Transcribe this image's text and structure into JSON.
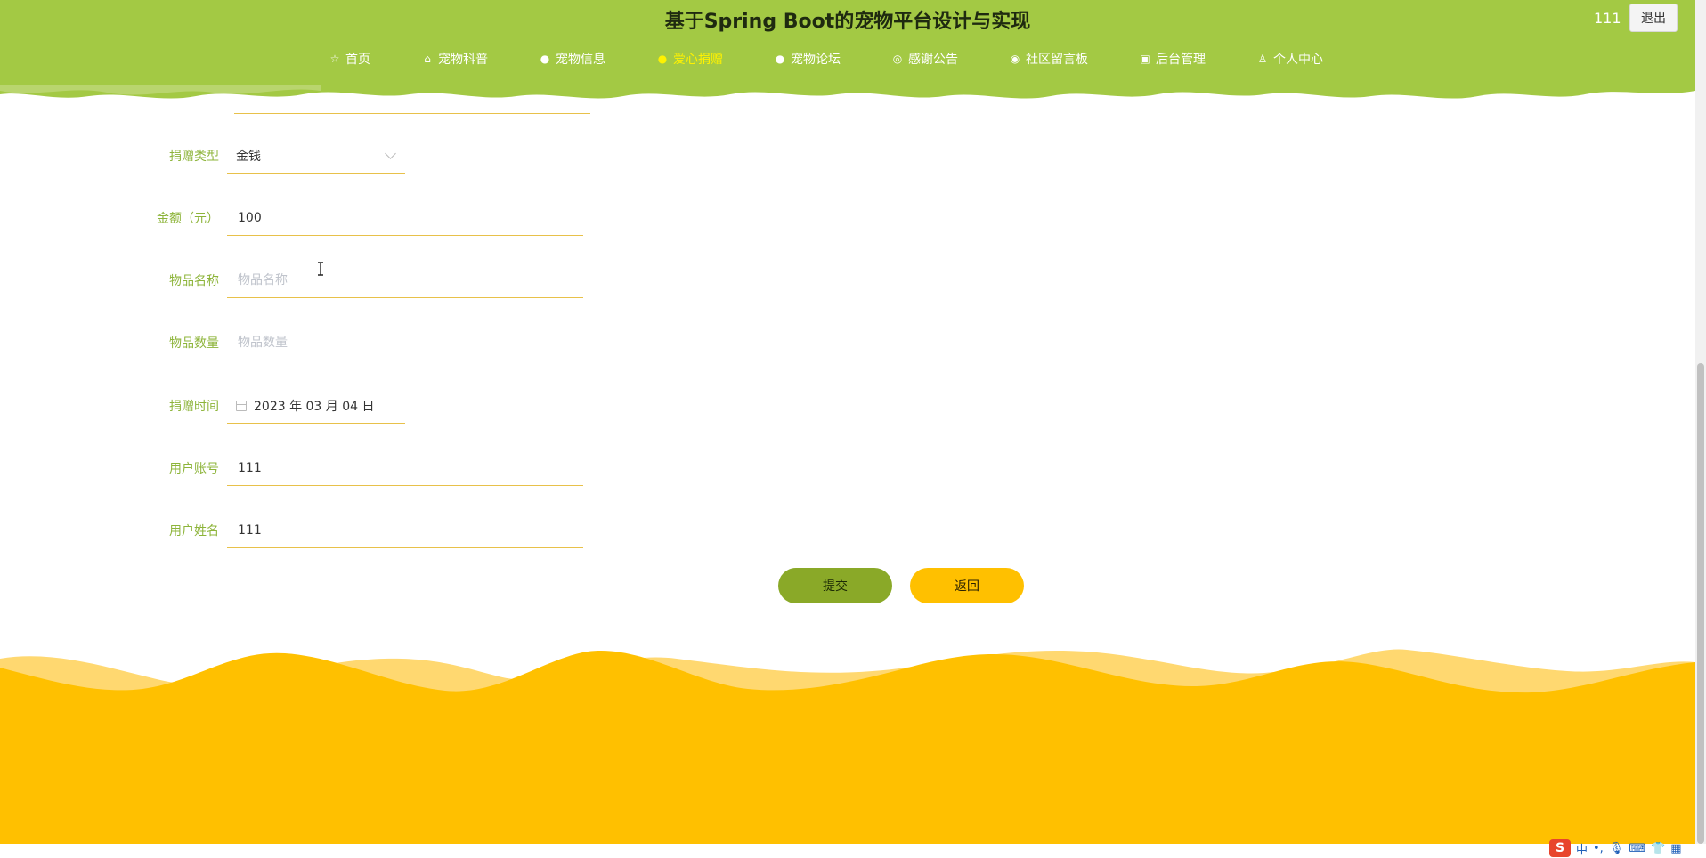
{
  "site": {
    "title": "基于Spring Boot的宠物平台设计与实现"
  },
  "nav": {
    "items": [
      {
        "label": "首页",
        "icon": "star-icon",
        "active": false
      },
      {
        "label": "宠物科普",
        "icon": "bag-icon",
        "active": false
      },
      {
        "label": "宠物信息",
        "icon": "info-icon",
        "active": false
      },
      {
        "label": "爱心捐赠",
        "icon": "circle-icon",
        "active": true
      },
      {
        "label": "宠物论坛",
        "icon": "info-icon",
        "active": false
      },
      {
        "label": "感谢公告",
        "icon": "globe-icon",
        "active": false
      },
      {
        "label": "社区留言板",
        "icon": "check-circle-icon",
        "active": false
      },
      {
        "label": "后台管理",
        "icon": "clipboard-icon",
        "active": false
      },
      {
        "label": "个人中心",
        "icon": "user-icon",
        "active": false
      }
    ]
  },
  "user": {
    "name": "111",
    "logout_label": "退出"
  },
  "form": {
    "donation_type": {
      "label": "捐赠类型",
      "value": "金钱"
    },
    "amount": {
      "label": "金额（元）",
      "value": "100"
    },
    "item_name": {
      "label": "物品名称",
      "value": "",
      "placeholder": "物品名称"
    },
    "item_quantity": {
      "label": "物品数量",
      "value": "",
      "placeholder": "物品数量"
    },
    "donation_time": {
      "label": "捐赠时间",
      "value": "2023 年 03 月 04 日"
    },
    "user_account": {
      "label": "用户账号",
      "value": "111"
    },
    "user_name": {
      "label": "用户姓名",
      "value": "111"
    },
    "submit_label": "提交",
    "back_label": "返回"
  },
  "ime": {
    "logo": "S",
    "mode": "中",
    "punct": "•,"
  },
  "colors": {
    "header_bg": "#a3c944",
    "nav_active": "#fff200",
    "label": "#8db43a",
    "underline": "#e8c14a",
    "submit_bg": "#8aa928",
    "back_bg": "#ffc000",
    "footer_wave": "#ffc000"
  }
}
